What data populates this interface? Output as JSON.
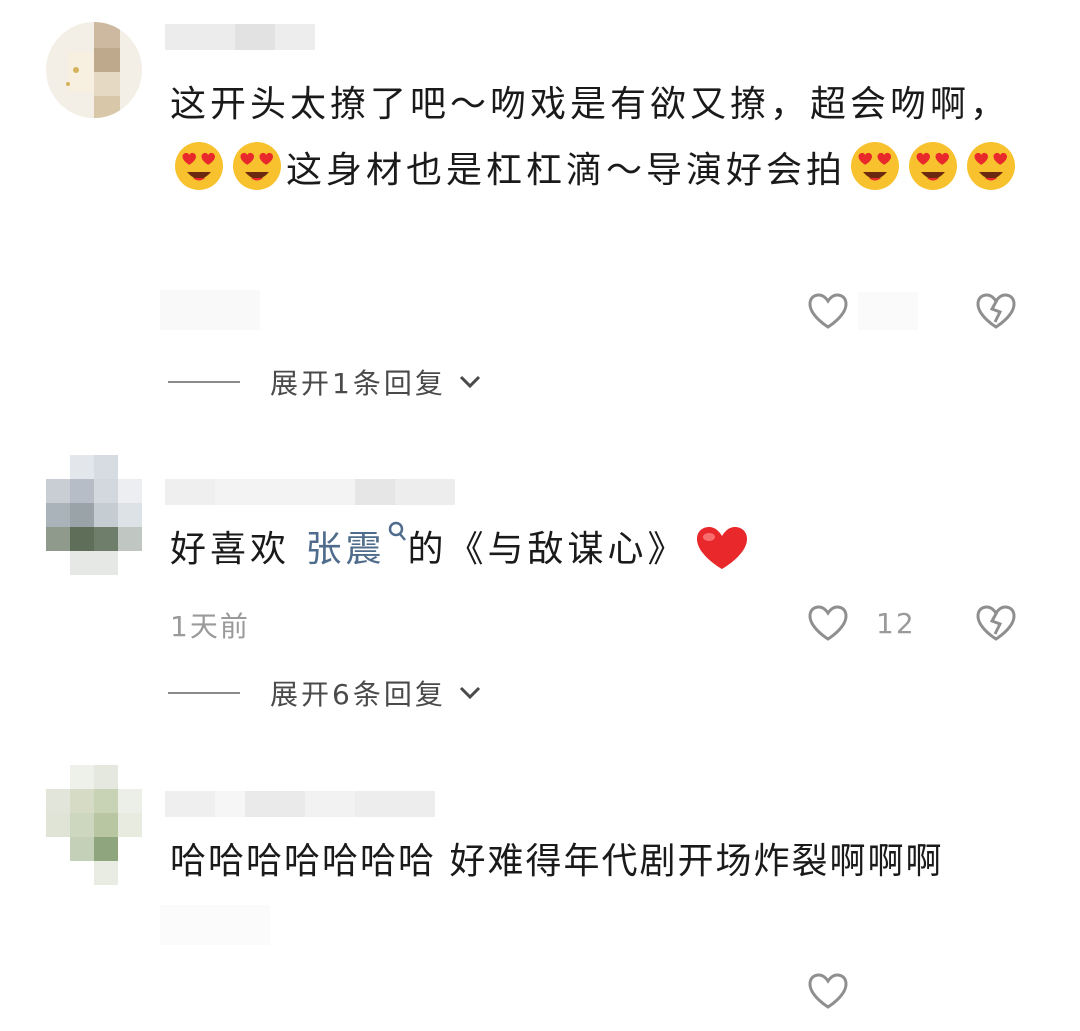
{
  "comments": [
    {
      "text_parts": [
        "这开头太撩了吧～吻戏是有欲又撩，超会吻啊，",
        "这身材也是杠杠滴～导演好会拍"
      ],
      "like_count": "",
      "expand_label": "展开1条回复"
    },
    {
      "text_before": "好喜欢 ",
      "mention": "张震",
      "text_after": "的《与敌谋心》",
      "time": "1天前",
      "like_count": "12",
      "expand_label": "展开6条回复"
    },
    {
      "text": "哈哈哈哈哈哈哈 好难得年代剧开场炸裂啊啊啊"
    }
  ],
  "icons": {
    "like": "heart-outline-icon",
    "dislike": "broken-heart-icon",
    "expand": "chevron-down-icon",
    "emoji": "heart-eyes-emoji",
    "red_heart": "red-heart-emoji",
    "search": "search-icon"
  },
  "colors": {
    "mention": "#4f6c8c",
    "meta": "#9a9a9a",
    "heart": "#e8282b"
  }
}
